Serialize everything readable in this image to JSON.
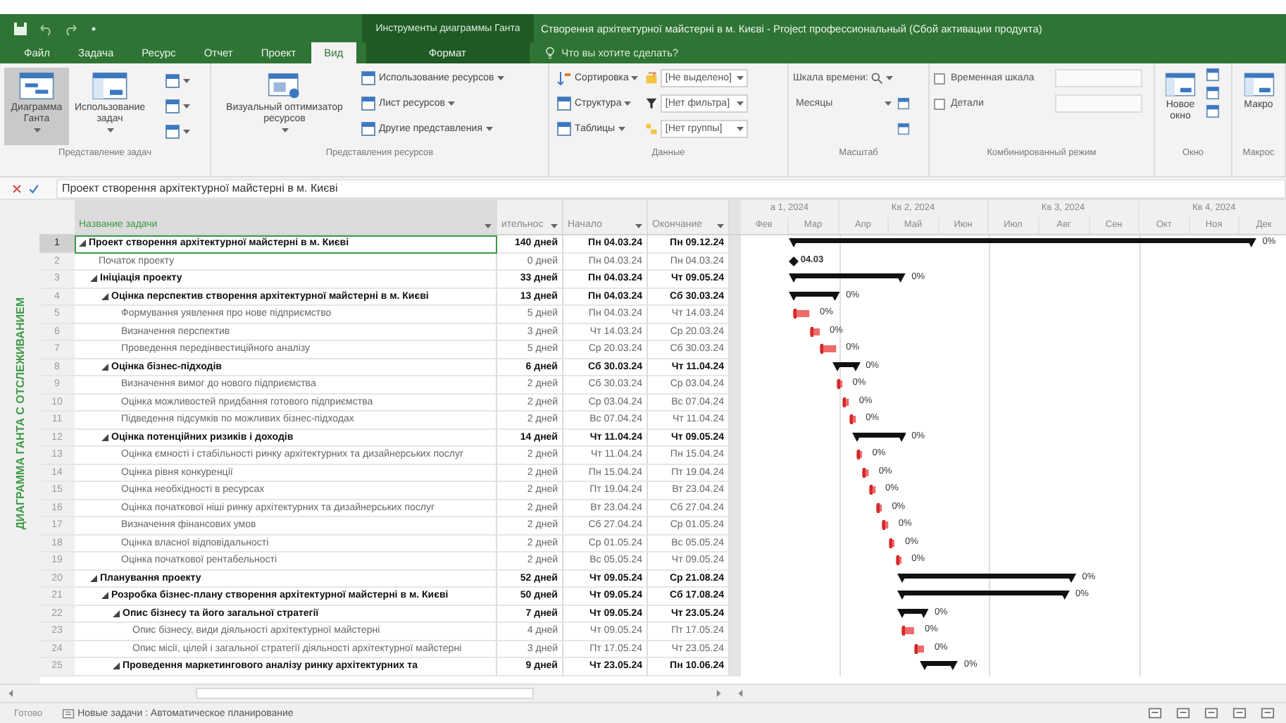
{
  "title_bar": {
    "contextual_group": "Инструменты диаграммы Ганта",
    "title": "Створення архітектурної майстерні в м. Києві - Project профессиональный (Сбой активации продукта)"
  },
  "tabs": [
    {
      "label": "Файл",
      "selected": false,
      "kind": "main"
    },
    {
      "label": "Задача",
      "selected": false,
      "kind": "main"
    },
    {
      "label": "Ресурс",
      "selected": false,
      "kind": "main"
    },
    {
      "label": "Отчет",
      "selected": false,
      "kind": "main"
    },
    {
      "label": "Проект",
      "selected": false,
      "kind": "main"
    },
    {
      "label": "Вид",
      "selected": true,
      "kind": "main"
    },
    {
      "label": "Формат",
      "selected": false,
      "kind": "contextual"
    }
  ],
  "tell_me": {
    "placeholder": "Что вы хотите сделать?"
  },
  "ribbon": {
    "task_views": {
      "label": "Представление задач",
      "buttons": [
        {
          "label": "Диаграмма Ганта",
          "selected": true
        },
        {
          "label": "Использование задач",
          "selected": false
        }
      ]
    },
    "resource_views": {
      "label": "Представления ресурсов",
      "optimizer": "Визуальный оптимизатор ресурсов",
      "items": [
        "Использование ресурсов",
        "Лист ресурсов",
        "Другие представления"
      ]
    },
    "data": {
      "label": "Данные",
      "items": [
        "Сортировка",
        "Структура",
        "Таблицы"
      ],
      "selects": [
        "[Не выделено]",
        "[Нет фильтра]",
        "[Нет группы]"
      ]
    },
    "zoom": {
      "label": "Масштаб",
      "timescale_label": "Шкала времени:",
      "timescale": "Месяцы"
    },
    "split_view": {
      "label": "Комбинированный режим",
      "options": [
        {
          "label": "Временная шкала",
          "checked": false
        },
        {
          "label": "Детали",
          "checked": false
        }
      ]
    },
    "window": {
      "label": "Окно",
      "new_window": "Новое окно"
    },
    "macros": {
      "label": "Макрос",
      "button": "Макро"
    }
  },
  "entry_bar": {
    "value": "Проект створення архітектурної майстерні в м. Києві"
  },
  "view_label": "ДИАГРАММА ГАНТА С ОТСЛЕЖИВАНИЕМ",
  "columns": [
    {
      "label": "Название задачи",
      "selected": true
    },
    {
      "label": "ительнос",
      "selected": false
    },
    {
      "label": "Начало",
      "selected": false
    },
    {
      "label": "Окончание",
      "selected": false
    }
  ],
  "timescale": {
    "quarters": [
      "а 1, 2024",
      "Кв 2, 2024",
      "Кв 3, 2024",
      "Кв 4, 2024"
    ],
    "months": [
      "Фев",
      "Мар",
      "Апр",
      "Май",
      "Июн",
      "Июл",
      "Авг",
      "Сен",
      "Окт",
      "Ноя",
      "Дек"
    ]
  },
  "tasks": [
    {
      "id": "1",
      "name": "Проект створення архітектурної майстерні в м. Києві",
      "duration": "140 дней",
      "start": "Пн 04.03.24",
      "finish": "Пн 09.12.24",
      "kind": "summary",
      "bar_label": "0%",
      "selected": true,
      "expanded": true,
      "children": [
        {
          "id": "2",
          "name": "Початок проекту",
          "duration": "0 дней",
          "start": "Пн 04.03.24",
          "finish": "Пн 04.03.24",
          "kind": "milestone",
          "bar_label": "04.03",
          "selected": false
        },
        {
          "id": "3",
          "name": "Ініціація проекту",
          "duration": "33 дней",
          "start": "Пн 04.03.24",
          "finish": "Чт 09.05.24",
          "kind": "summary",
          "bar_label": "0%",
          "selected": false,
          "expanded": true,
          "children": [
            {
              "id": "4",
              "name": "Оцінка перспектив створення архітектурної майстерні в м. Києві",
              "duration": "13 дней",
              "start": "Пн 04.03.24",
              "finish": "Сб 30.03.24",
              "kind": "summary",
              "bar_label": "0%",
              "selected": false,
              "expanded": true,
              "children": [
                {
                  "id": "5",
                  "name": "Формування уявлення про нове підприємство",
                  "duration": "5 дней",
                  "start": "Пн 04.03.24",
                  "finish": "Чт 14.03.24",
                  "kind": "task",
                  "bar_label": "0%",
                  "selected": false
                },
                {
                  "id": "6",
                  "name": "Визначення перспектив",
                  "duration": "3 дней",
                  "start": "Чт 14.03.24",
                  "finish": "Ср 20.03.24",
                  "kind": "task",
                  "bar_label": "0%",
                  "selected": false
                },
                {
                  "id": "7",
                  "name": "Проведення передінвестиційного аналізу",
                  "duration": "5 дней",
                  "start": "Ср 20.03.24",
                  "finish": "Сб 30.03.24",
                  "kind": "task",
                  "bar_label": "0%",
                  "selected": false
                }
              ]
            },
            {
              "id": "8",
              "name": "Оцінка бізнес-підходів",
              "duration": "6 дней",
              "start": "Сб 30.03.24",
              "finish": "Чт 11.04.24",
              "kind": "summary",
              "bar_label": "0%",
              "selected": false,
              "expanded": true,
              "children": [
                {
                  "id": "9",
                  "name": "Визначення вимог до нового підприємства",
                  "duration": "2 дней",
                  "start": "Сб 30.03.24",
                  "finish": "Ср 03.04.24",
                  "kind": "task",
                  "bar_label": "0%",
                  "selected": false
                },
                {
                  "id": "10",
                  "name": "Оцінка можливостей придбання готового підприємства",
                  "duration": "2 дней",
                  "start": "Ср 03.04.24",
                  "finish": "Вс 07.04.24",
                  "kind": "task",
                  "bar_label": "0%",
                  "selected": false
                },
                {
                  "id": "11",
                  "name": "Підведення підсумків по можливих бізнес-підходах",
                  "duration": "2 дней",
                  "start": "Вс 07.04.24",
                  "finish": "Чт 11.04.24",
                  "kind": "task",
                  "bar_label": "0%",
                  "selected": false
                }
              ]
            },
            {
              "id": "12",
              "name": "Оцінка потенційних ризиків і доходів",
              "duration": "14 дней",
              "start": "Чт 11.04.24",
              "finish": "Чт 09.05.24",
              "kind": "summary",
              "bar_label": "0%",
              "selected": false,
              "expanded": true,
              "children": [
                {
                  "id": "13",
                  "name": "Оцінка ємності і стабільності ринку архітектурних та дизайнерських послуг",
                  "duration": "2 дней",
                  "start": "Чт 11.04.24",
                  "finish": "Пн 15.04.24",
                  "kind": "task",
                  "bar_label": "0%",
                  "selected": false
                },
                {
                  "id": "14",
                  "name": "Оцінка рівня конкуренції",
                  "duration": "2 дней",
                  "start": "Пн 15.04.24",
                  "finish": "Пт 19.04.24",
                  "kind": "task",
                  "bar_label": "0%",
                  "selected": false
                },
                {
                  "id": "15",
                  "name": "Оцінка необхідності в ресурсах",
                  "duration": "2 дней",
                  "start": "Пт 19.04.24",
                  "finish": "Вт 23.04.24",
                  "kind": "task",
                  "bar_label": "0%",
                  "selected": false
                },
                {
                  "id": "16",
                  "name": "Оцінка початкової ніші ринку архітектурних та дизайнерських послуг",
                  "duration": "2 дней",
                  "start": "Вт 23.04.24",
                  "finish": "Сб 27.04.24",
                  "kind": "task",
                  "bar_label": "0%",
                  "selected": false
                },
                {
                  "id": "17",
                  "name": "Визначення фінансових умов",
                  "duration": "2 дней",
                  "start": "Сб 27.04.24",
                  "finish": "Ср 01.05.24",
                  "kind": "task",
                  "bar_label": "0%",
                  "selected": false
                },
                {
                  "id": "18",
                  "name": "Оцінка власної відповідальності",
                  "duration": "2 дней",
                  "start": "Ср 01.05.24",
                  "finish": "Вс 05.05.24",
                  "kind": "task",
                  "bar_label": "0%",
                  "selected": false
                },
                {
                  "id": "19",
                  "name": "Оцінка початкової рентабельності",
                  "duration": "2 дней",
                  "start": "Вс 05.05.24",
                  "finish": "Чт 09.05.24",
                  "kind": "task",
                  "bar_label": "0%",
                  "selected": false
                }
              ]
            }
          ]
        },
        {
          "id": "20",
          "name": "Планування проекту",
          "duration": "52 дней",
          "start": "Чт 09.05.24",
          "finish": "Ср 21.08.24",
          "kind": "summary",
          "bar_label": "0%",
          "selected": false,
          "expanded": true,
          "children": [
            {
              "id": "21",
              "name": "Розробка бізнес-плану створення архітектурної майстерні в м. Києві",
              "duration": "50 дней",
              "start": "Чт 09.05.24",
              "finish": "Сб 17.08.24",
              "kind": "summary",
              "bar_label": "0%",
              "selected": false,
              "expanded": true,
              "children": [
                {
                  "id": "22",
                  "name": "Опис бізнесу та його загальної стратегії",
                  "duration": "7 дней",
                  "start": "Чт 09.05.24",
                  "finish": "Чт 23.05.24",
                  "kind": "summary",
                  "bar_label": "0%",
                  "selected": false,
                  "expanded": true,
                  "children": [
                    {
                      "id": "23",
                      "name": "Опис бізнесу, види діяльності архітектурної майстерні",
                      "duration": "4 дней",
                      "start": "Чт 09.05.24",
                      "finish": "Пт 17.05.24",
                      "kind": "task",
                      "bar_label": "0%",
                      "selected": false
                    },
                    {
                      "id": "24",
                      "name": "Опис місії, цілей і загальної стратегії діяльності архітектурної майстерні",
                      "duration": "3 дней",
                      "start": "Пт 17.05.24",
                      "finish": "Чт 23.05.24",
                      "kind": "task",
                      "bar_label": "0%",
                      "selected": false
                    }
                  ]
                },
                {
                  "id": "25",
                  "name": "Проведення маркетингового аналізу ринку архітектурних та",
                  "duration": "9 дней",
                  "start": "Чт 23.05.24",
                  "finish": "Пн 10.06.24",
                  "kind": "summary",
                  "bar_label": "0%",
                  "selected": false,
                  "expanded": true
                }
              ]
            }
          ]
        }
      ]
    }
  ],
  "status_bar": {
    "status": "Готово",
    "new_tasks": "Новые задачи : Автоматическое планирование"
  }
}
